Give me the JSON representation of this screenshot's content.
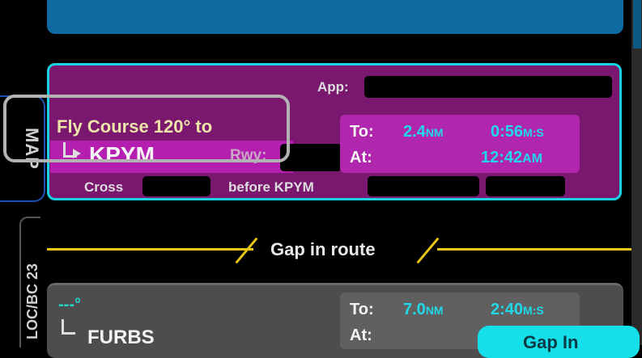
{
  "side_tabs": {
    "map": "MAP",
    "loc": "LOC/BC 23"
  },
  "active_leg": {
    "app_label": "App:",
    "instruction": "Fly Course 120° to",
    "waypoint": "KPYM",
    "rwy_label": "Rwy:",
    "cross_label": "Cross",
    "before_label": "before KPYM",
    "to_label": "To:",
    "to_distance": "2.4",
    "to_distance_unit": "NM",
    "to_time": "0:56",
    "to_time_unit": "M:S",
    "at_label": "At:",
    "at_time": "12:42",
    "at_time_unit": "AM"
  },
  "gap": {
    "label": "Gap in route"
  },
  "next_leg": {
    "course": "---°",
    "waypoint": "FURBS",
    "to_label": "To:",
    "to_distance": "7.0",
    "to_distance_unit": "NM",
    "to_time": "2:40",
    "to_time_unit": "M:S",
    "at_label": "At:",
    "gap_in_button": "Gap In"
  },
  "colors": {
    "active_leg_bg": "#7a176e",
    "active_border": "#19d2e2",
    "accent_cyan": "#20d8e8",
    "gap_line": "#e9c515",
    "next_leg_bg": "#4d4d4d",
    "top_leg_bg": "#0f6aa0"
  }
}
